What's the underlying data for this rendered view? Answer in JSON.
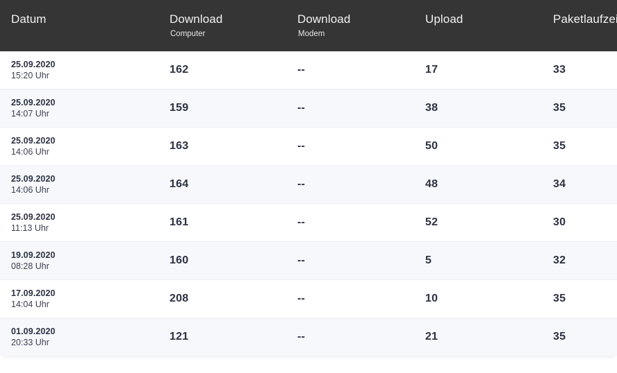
{
  "table": {
    "columns": [
      {
        "title": "Datum",
        "subtitle": ""
      },
      {
        "title": "Download",
        "subtitle": "Computer"
      },
      {
        "title": "Download",
        "subtitle": "Modem"
      },
      {
        "title": "Upload",
        "subtitle": ""
      },
      {
        "title": "Paketlaufzeit",
        "subtitle": ""
      }
    ],
    "rows": [
      {
        "date": "25.09.2020",
        "time": "15:20 Uhr",
        "download_computer": "162",
        "download_modem": "--",
        "upload": "17",
        "paketlaufzeit": "33"
      },
      {
        "date": "25.09.2020",
        "time": "14:07 Uhr",
        "download_computer": "159",
        "download_modem": "--",
        "upload": "38",
        "paketlaufzeit": "35"
      },
      {
        "date": "25.09.2020",
        "time": "14:06 Uhr",
        "download_computer": "163",
        "download_modem": "--",
        "upload": "50",
        "paketlaufzeit": "35"
      },
      {
        "date": "25.09.2020",
        "time": "14:06 Uhr",
        "download_computer": "164",
        "download_modem": "--",
        "upload": "48",
        "paketlaufzeit": "34"
      },
      {
        "date": "25.09.2020",
        "time": "11:13 Uhr",
        "download_computer": "161",
        "download_modem": "--",
        "upload": "52",
        "paketlaufzeit": "30"
      },
      {
        "date": "19.09.2020",
        "time": "08:28 Uhr",
        "download_computer": "160",
        "download_modem": "--",
        "upload": "5",
        "paketlaufzeit": "32"
      },
      {
        "date": "17.09.2020",
        "time": "14:04 Uhr",
        "download_computer": "208",
        "download_modem": "--",
        "upload": "10",
        "paketlaufzeit": "35"
      },
      {
        "date": "01.09.2020",
        "time": "20:33 Uhr",
        "download_computer": "121",
        "download_modem": "--",
        "upload": "21",
        "paketlaufzeit": "35"
      }
    ]
  },
  "colors": {
    "header_background": "#353535",
    "header_text": "#f2f2f2",
    "row_background": "#ffffff",
    "row_alt_background": "#f7f8fc",
    "row_border": "#eceef5",
    "value_text": "#2c3142"
  }
}
